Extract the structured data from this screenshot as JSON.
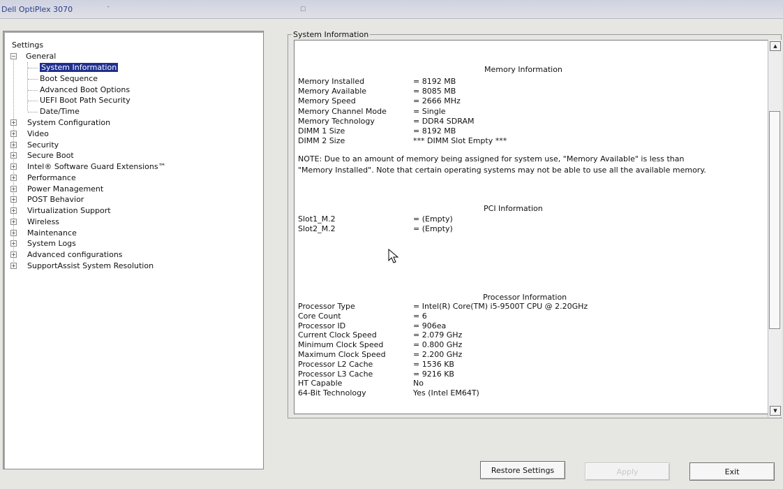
{
  "window": {
    "title": "Dell OptiPlex 3070"
  },
  "tree": {
    "root_label": "Settings",
    "general": {
      "label": "General",
      "children": [
        {
          "label": "System Information",
          "selected": true
        },
        {
          "label": "Boot Sequence"
        },
        {
          "label": "Advanced Boot Options"
        },
        {
          "label": "UEFI Boot Path Security"
        },
        {
          "label": "Date/Time"
        }
      ]
    },
    "items": [
      "System Configuration",
      "Video",
      "Security",
      "Secure Boot",
      "Intel® Software Guard Extensions™",
      "Performance",
      "Power Management",
      "POST Behavior",
      "Virtualization Support",
      "Wireless",
      "Maintenance",
      "System Logs",
      "Advanced configurations",
      "SupportAssist System Resolution"
    ]
  },
  "panel": {
    "title": "System Information",
    "memory": {
      "heading": "Memory Information",
      "rows": [
        {
          "label": "Memory Installed",
          "value": "= 8192 MB"
        },
        {
          "label": "Memory Available",
          "value": "= 8085 MB"
        },
        {
          "label": "Memory Speed",
          "value": "= 2666 MHz"
        },
        {
          "label": "Memory Channel Mode",
          "value": "= Single"
        },
        {
          "label": "Memory Technology",
          "value": "= DDR4 SDRAM"
        },
        {
          "label": "DIMM 1 Size",
          "value": "= 8192 MB"
        },
        {
          "label": "DIMM 2 Size",
          "value": "*** DIMM Slot Empty ***"
        }
      ],
      "note": "NOTE: Due to an amount of memory being assigned for system use, \"Memory Available\" is less than \"Memory Installed\". Note that certain operating systems may not be able to use all the available memory."
    },
    "pci": {
      "heading": "PCI Information",
      "rows": [
        {
          "label": "Slot1_M.2",
          "value": "= (Empty)"
        },
        {
          "label": "Slot2_M.2",
          "value": "= (Empty)"
        }
      ]
    },
    "processor": {
      "heading": "Processor Information",
      "rows": [
        {
          "label": "Processor Type",
          "value": "= Intel(R) Core(TM) i5-9500T CPU @ 2.20GHz"
        },
        {
          "label": "Core Count",
          "value": "= 6"
        },
        {
          "label": "Processor ID",
          "value": "= 906ea"
        },
        {
          "label": "Current Clock Speed",
          "value": "= 2.079 GHz"
        },
        {
          "label": "Minimum Clock Speed",
          "value": "= 0.800 GHz"
        },
        {
          "label": "Maximum Clock Speed",
          "value": "= 2.200 GHz"
        },
        {
          "label": "Processor L2 Cache",
          "value": "= 1536 KB"
        },
        {
          "label": "Processor L3 Cache",
          "value": "= 9216 KB"
        },
        {
          "label": "HT Capable",
          "value": "No"
        },
        {
          "label": "64-Bit Technology",
          "value": "Yes (Intel EM64T)"
        }
      ]
    }
  },
  "buttons": {
    "restore": "Restore Settings",
    "apply": "Apply",
    "exit": "Exit"
  },
  "colors": {
    "selection": "#1f2f8f",
    "title_text": "#2b3c8a"
  }
}
